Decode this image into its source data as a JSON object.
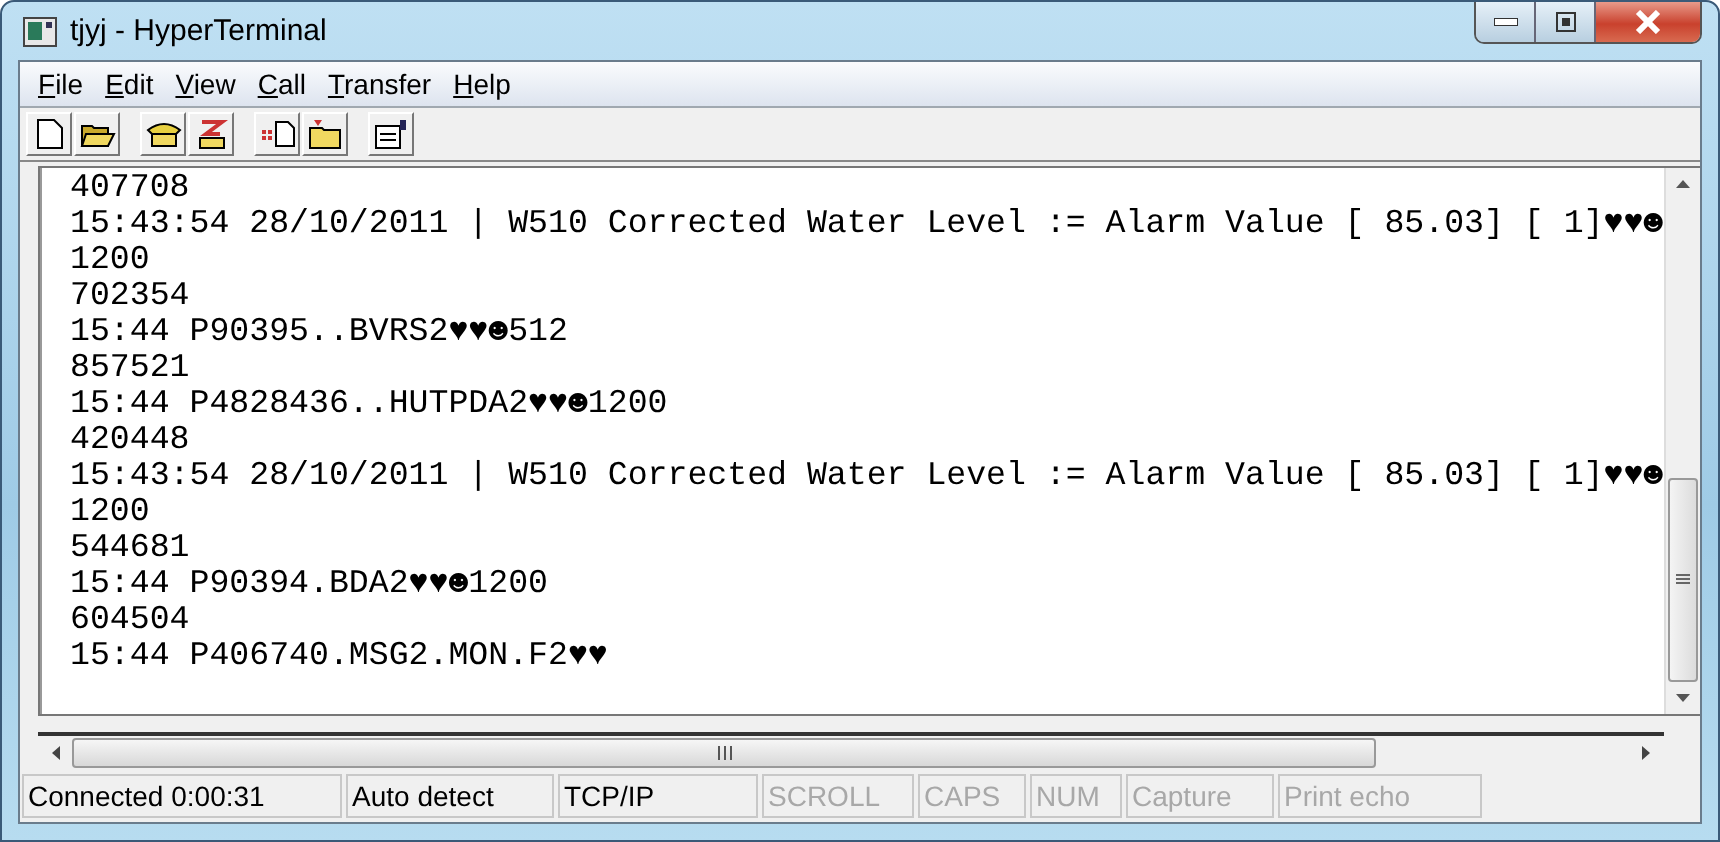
{
  "window": {
    "title": "tjyj - HyperTerminal"
  },
  "menu": [
    {
      "label": "File"
    },
    {
      "label": "Edit"
    },
    {
      "label": "View"
    },
    {
      "label": "Call"
    },
    {
      "label": "Transfer"
    },
    {
      "label": "Help"
    }
  ],
  "terminal": {
    "lines": [
      "407708",
      "15:43:54 28/10/2011 | W510 Corrected Water Level := Alarm Value [ 85.03] [ 1]♥♥☻",
      "1200",
      "702354",
      "15:44 P90395..BVRS2♥♥☻512",
      "857521",
      "15:44 P4828436..HUTPDA2♥♥☻1200",
      "420448",
      "15:43:54 28/10/2011 | W510 Corrected Water Level := Alarm Value [ 85.03] [ 1]♥♥☻",
      "1200",
      "544681",
      "15:44 P90394.BDA2♥♥☻1200",
      "604504",
      "15:44 P406740.MSG2.MON.F2♥♥"
    ]
  },
  "status_bar": [
    {
      "text": "Connected 0:00:31",
      "disabled": false
    },
    {
      "text": "Auto detect",
      "disabled": false
    },
    {
      "text": "TCP/IP",
      "disabled": false
    },
    {
      "text": "SCROLL",
      "disabled": true
    },
    {
      "text": "CAPS",
      "disabled": true
    },
    {
      "text": "NUM",
      "disabled": true
    },
    {
      "text": "Capture",
      "disabled": true
    },
    {
      "text": "Print echo",
      "disabled": true
    }
  ]
}
